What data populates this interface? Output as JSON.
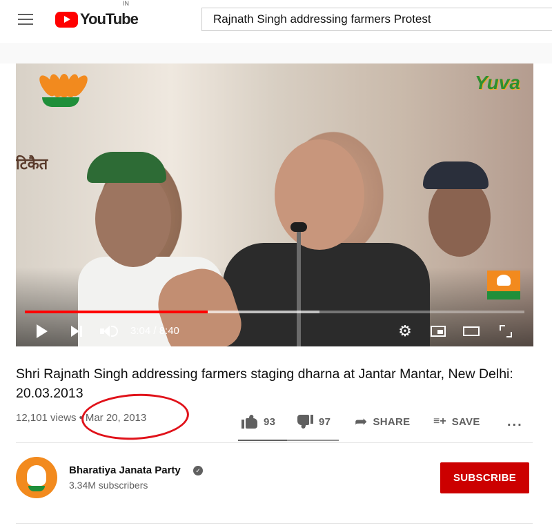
{
  "header": {
    "brand": "YouTube",
    "country": "IN",
    "search_value": "Rajnath Singh addressing farmers Protest"
  },
  "player": {
    "overlay_text": "टिकैत",
    "channel_watermark": "Yuva",
    "time": "3:04 / 8:40",
    "progress_fraction": 0.366,
    "buffer_fraction": 0.59
  },
  "video": {
    "title": "Shri Rajnath Singh addressing farmers staging dharna at Jantar Mantar, New Delhi: 20.03.2013",
    "views": "12,101 views",
    "separator": "•",
    "date": "Mar 20, 2013"
  },
  "actions": {
    "likes": "93",
    "dislikes": "97",
    "share_label": "SHARE",
    "save_label": "SAVE",
    "more_label": "..."
  },
  "channel": {
    "name": "Bharatiya Janata Party",
    "subscribers": "3.34M subscribers",
    "subscribe_label": "SUBSCRIBE"
  },
  "colors": {
    "brand_red": "#ff0000",
    "subscribe_red": "#cc0000",
    "annotation_red": "#e0121a"
  },
  "icons": [
    "menu-icon",
    "youtube-logo-icon",
    "play-icon",
    "next-icon",
    "volume-icon",
    "gear-icon",
    "miniplayer-icon",
    "theater-icon",
    "fullscreen-icon",
    "thumbs-up-icon",
    "thumbs-down-icon",
    "share-icon",
    "save-playlist-icon",
    "more-icon",
    "verified-icon"
  ]
}
